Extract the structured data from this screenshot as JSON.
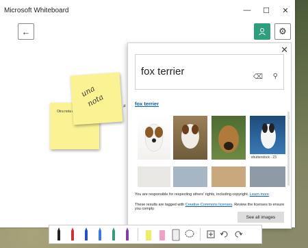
{
  "window": {
    "title": "Microsoft Whiteboard"
  },
  "window_controls": {
    "minimize": "—",
    "maximize": "☐",
    "close": "✕"
  },
  "notes": {
    "note1_line1": "una",
    "note1_line2": "nota",
    "note2": "Otra nota de texto"
  },
  "image_search": {
    "query": "fox terrier",
    "result_link": "fox terrier",
    "caption": "shutterstock · 23",
    "rights_text": "You are responsible for respecting others' rights, including copyright.",
    "learn_more": "Learn more",
    "cc_prefix": "These results are tagged with",
    "cc_link": "Creative Commons licenses",
    "cc_suffix": ". Review the licenses to ensure you comply.",
    "see_all": "See all images"
  },
  "colors": {
    "accent": "#2e9e7e",
    "note": "#fbf393",
    "link": "#0a5fa8"
  },
  "toolbar": {
    "tools": [
      "black-pen-icon",
      "red-pen-icon",
      "blue-pen-icon",
      "blue-pen-icon",
      "teal-pen-icon",
      "purple-pen-icon",
      "yellow-highlighter-icon",
      "pink-highlighter-icon",
      "ruler-icon",
      "lasso-icon",
      "add-icon",
      "undo-icon",
      "redo-icon"
    ]
  }
}
